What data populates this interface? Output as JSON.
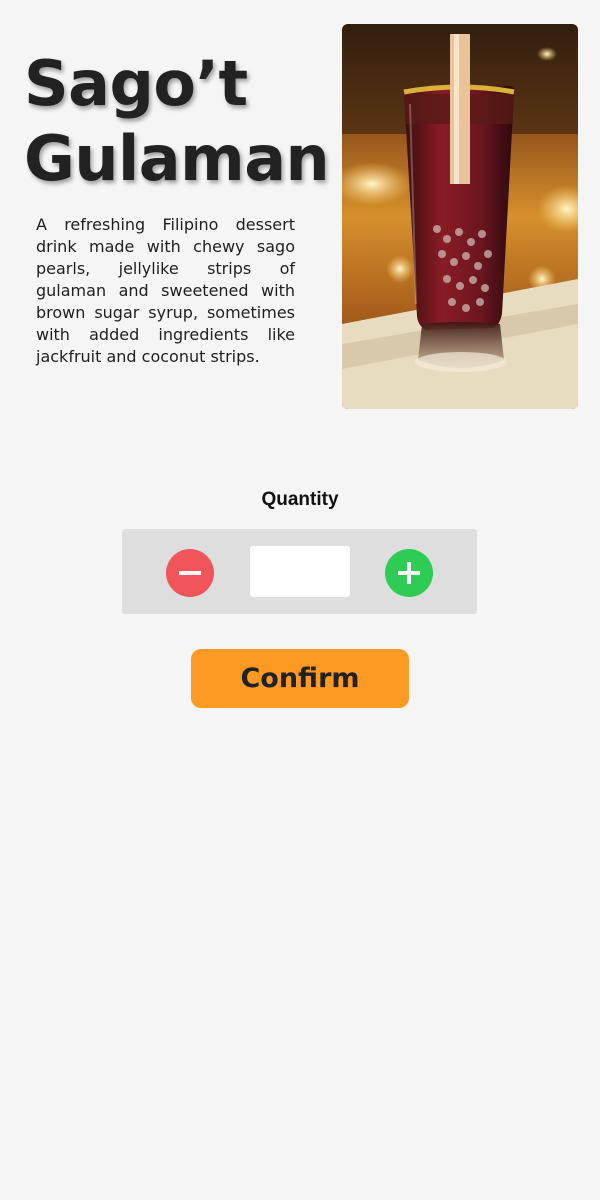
{
  "product": {
    "title_line1": "Sago’t",
    "title_line2": "Gulaman",
    "description": "A refreshing Filipino dessert drink made with chewy sago pearls, jellylike strips of gulaman and sweetened with brown sugar syrup, sometimes with added ingredients like jackfruit and coconut strips.",
    "image_alt": "Sago’t Gulaman"
  },
  "quantity": {
    "label": "Quantity",
    "value": "",
    "decrement_icon": "minus-icon",
    "increment_icon": "plus-icon"
  },
  "actions": {
    "confirm_label": "Confirm"
  },
  "colors": {
    "background": "#f5f5f5",
    "decrement": "#f0555a",
    "increment": "#2ecc55",
    "confirm": "#fd9a23",
    "stepper_bg": "#dedede"
  }
}
